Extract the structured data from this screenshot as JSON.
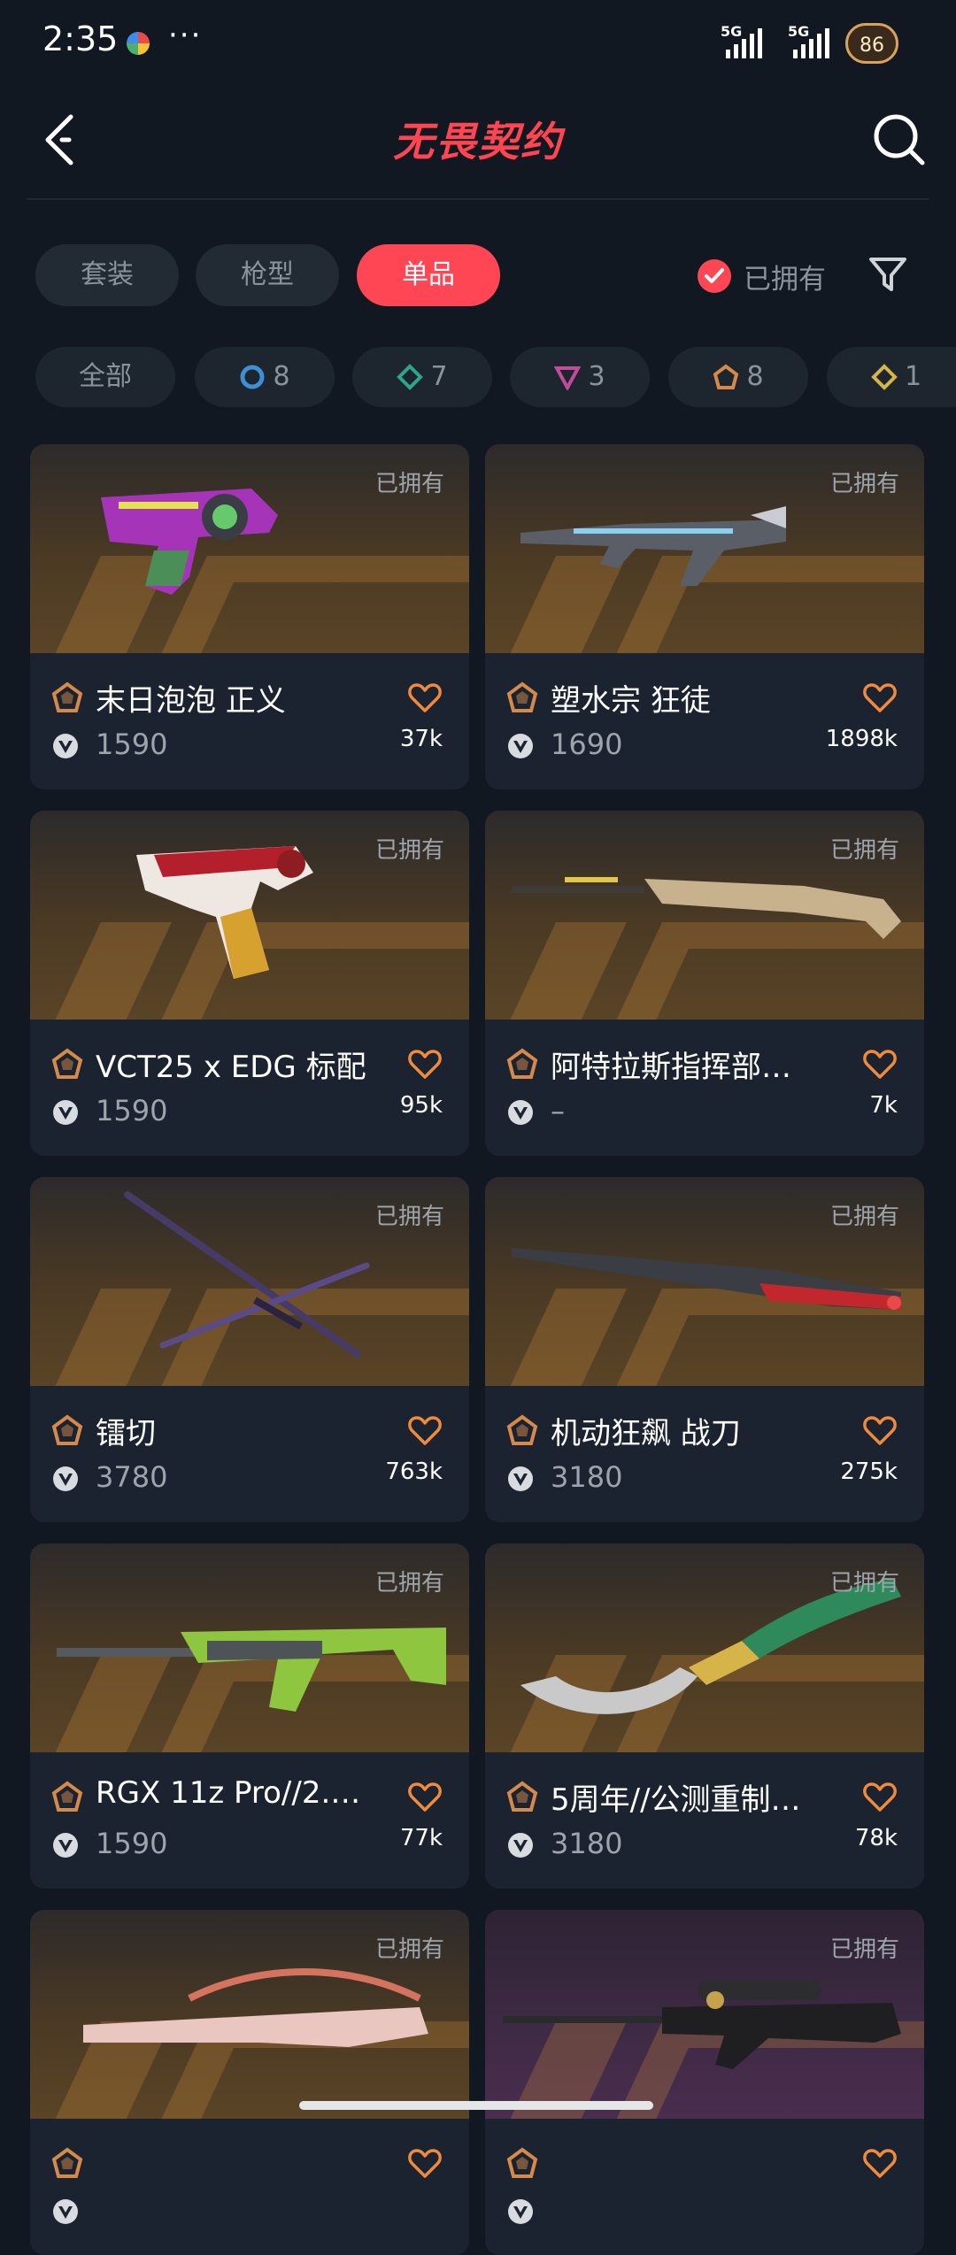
{
  "status": {
    "time": "2:35",
    "more": "···",
    "net1": "5G",
    "net2": "5G",
    "battery": "86"
  },
  "header": {
    "title": "无畏契约"
  },
  "tabs": [
    {
      "label": "套装"
    },
    {
      "label": "枪型"
    },
    {
      "label": "单品",
      "active": true
    }
  ],
  "owned_toggle": {
    "label": "已拥有",
    "checked": true
  },
  "chips": [
    {
      "label": "全部"
    },
    {
      "label": "8",
      "icon": "ring-tier-icon",
      "color": "#3d8fd6"
    },
    {
      "label": "7",
      "icon": "diamond-tier-icon",
      "color": "#2fa58d"
    },
    {
      "label": "3",
      "icon": "triangle-tier-icon",
      "color": "#c24b9a"
    },
    {
      "label": "8",
      "icon": "pentagon-tier-icon",
      "color": "#d68a4a"
    },
    {
      "label": "1",
      "icon": "rhombus-tier-icon",
      "color": "#d6b548"
    }
  ],
  "items": [
    {
      "name": "末日泡泡 正义",
      "price": "1590",
      "likes": "37k",
      "owned": "已拥有",
      "weapon": "pistol-purple"
    },
    {
      "name": "塑水宗 狂徒",
      "price": "1690",
      "likes": "1898k",
      "owned": "已拥有",
      "weapon": "rifle-dark"
    },
    {
      "name": "VCT25 x EDG 标配",
      "price": "1590",
      "likes": "95k",
      "owned": "已拥有",
      "weapon": "pistol-red"
    },
    {
      "name": "阿特拉斯指挥部…",
      "price": "–",
      "likes": "7k",
      "owned": "已拥有",
      "weapon": "sniper-tan"
    },
    {
      "name": "镭切",
      "price": "3780",
      "likes": "763k",
      "owned": "已拥有",
      "weapon": "katanas"
    },
    {
      "name": "机动狂飙 战刀",
      "price": "3180",
      "likes": "275k",
      "owned": "已拥有",
      "weapon": "blade-red"
    },
    {
      "name": "RGX 11z Pro//2.…",
      "price": "1590",
      "likes": "77k",
      "owned": "已拥有",
      "weapon": "rifle-green"
    },
    {
      "name": "5周年//公测重制…",
      "price": "3180",
      "likes": "78k",
      "owned": "已拥有",
      "weapon": "knife-green"
    },
    {
      "name": "",
      "price": "",
      "likes": "",
      "owned": "已拥有",
      "weapon": "rifle-pink"
    },
    {
      "name": "",
      "price": "",
      "likes": "",
      "owned": "已拥有",
      "weapon": "sniper-black"
    }
  ]
}
